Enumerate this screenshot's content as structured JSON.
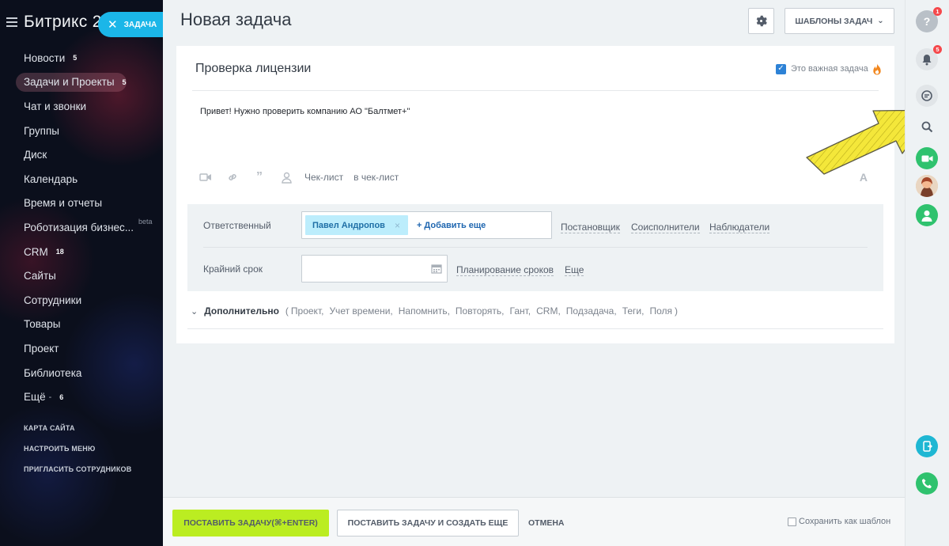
{
  "sidebar": {
    "logo": "Битрикс 24",
    "task_button": {
      "label": "ЗАДАЧА"
    },
    "menu": [
      {
        "label": "Новости",
        "count": "5"
      },
      {
        "label": "Задачи и Проекты",
        "count": "5",
        "active": true
      },
      {
        "label": "Чат и звонки"
      },
      {
        "label": "Группы"
      },
      {
        "label": "Диск"
      },
      {
        "label": "Календарь"
      },
      {
        "label": "Время и отчеты"
      },
      {
        "label": "Роботизация бизнес...",
        "badge": "beta"
      },
      {
        "label": "CRM",
        "count": "18"
      },
      {
        "label": "Сайты"
      },
      {
        "label": "Сотрудники"
      },
      {
        "label": "Товары"
      },
      {
        "label": "Проект"
      },
      {
        "label": "Библиотека"
      },
      {
        "label": "Ещё",
        "count": "6"
      }
    ],
    "small_links": [
      "КАРТА САЙТА",
      "НАСТРОИТЬ МЕНЮ",
      "ПРИГЛАСИТЬ СОТРУДНИКОВ"
    ]
  },
  "header": {
    "title": "Новая задача",
    "templates_label": "ШАБЛОНЫ ЗАДАЧ"
  },
  "task": {
    "title": "Проверка лицензии",
    "important_label": "Это важная задача",
    "important_checked": true,
    "description": "Привет! Нужно проверить компанию АО \"Балтмет+\"",
    "toolbar": {
      "checklist": "Чек-лист",
      "to_checklist": "в чек-лист",
      "font_letter": "A"
    },
    "responsible": {
      "label": "Ответственный",
      "user": "Павел Андропов",
      "remove_glyph": "×",
      "add_more": "+ Добавить еще",
      "links": [
        "Постановщик",
        "Соисполнители",
        "Наблюдатели"
      ]
    },
    "deadline": {
      "label": "Крайний срок",
      "value": "",
      "links": [
        "Планирование сроков",
        "Еще"
      ]
    },
    "additional": {
      "label": "Дополнительно",
      "open": "(",
      "close": ")",
      "items": [
        "Проект,",
        "Учет времени,",
        "Напомнить,",
        "Повторять,",
        "Гант,",
        "CRM,",
        "Подзадача,",
        "Теги,",
        "Поля"
      ]
    }
  },
  "footer": {
    "submit": "ПОСТАВИТЬ ЗАДАЧУ(⌘+ENTER)",
    "submit_and_new": "ПОСТАВИТЬ ЗАДАЧУ И СОЗДАТЬ ЕЩЕ",
    "cancel": "ОТМЕНА",
    "save_template": "Сохранить как шаблон"
  },
  "rail": {
    "help_badge": "1",
    "notifications_badge": "5"
  },
  "colors": {
    "accent_blue": "#1bb6e8",
    "submit_green": "#bbed21",
    "badge_red": "#f5484b",
    "annotation_arrow": "#f4e73a"
  }
}
